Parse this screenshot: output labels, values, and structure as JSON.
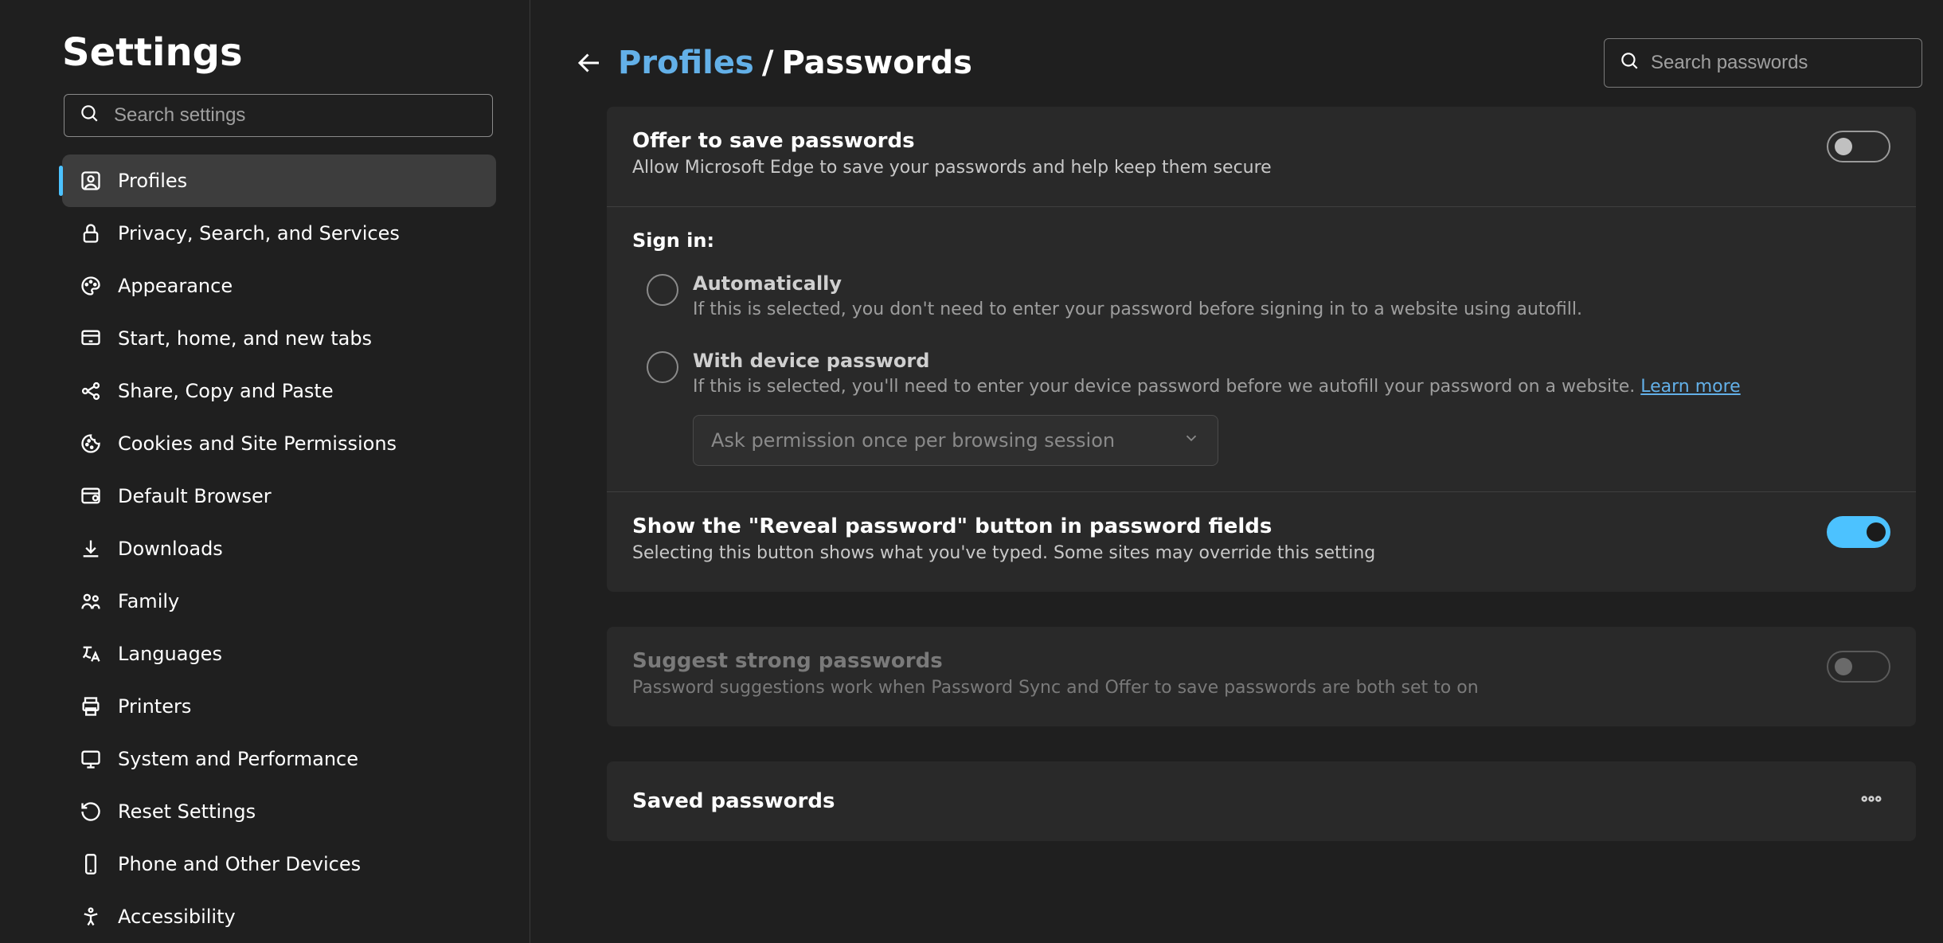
{
  "app_title": "Settings",
  "search_settings_placeholder": "Search settings",
  "nav": [
    {
      "id": "profiles",
      "label": "Profiles",
      "icon": "profile",
      "active": true
    },
    {
      "id": "privacy",
      "label": "Privacy, Search, and Services",
      "icon": "lock",
      "active": false
    },
    {
      "id": "appearance",
      "label": "Appearance",
      "icon": "palette",
      "active": false
    },
    {
      "id": "start",
      "label": "Start, home, and new tabs",
      "icon": "power",
      "active": false
    },
    {
      "id": "share",
      "label": "Share, Copy and Paste",
      "icon": "share",
      "active": false
    },
    {
      "id": "cookies",
      "label": "Cookies and Site Permissions",
      "icon": "cookie",
      "active": false
    },
    {
      "id": "browser",
      "label": "Default Browser",
      "icon": "browser",
      "active": false
    },
    {
      "id": "downloads",
      "label": "Downloads",
      "icon": "download",
      "active": false
    },
    {
      "id": "family",
      "label": "Family",
      "icon": "family",
      "active": false
    },
    {
      "id": "languages",
      "label": "Languages",
      "icon": "language",
      "active": false
    },
    {
      "id": "printers",
      "label": "Printers",
      "icon": "printer",
      "active": false
    },
    {
      "id": "system",
      "label": "System and Performance",
      "icon": "system",
      "active": false
    },
    {
      "id": "reset",
      "label": "Reset Settings",
      "icon": "reset",
      "active": false
    },
    {
      "id": "phone",
      "label": "Phone and Other Devices",
      "icon": "phone",
      "active": false
    },
    {
      "id": "accessibility",
      "label": "Accessibility",
      "icon": "accessibility",
      "active": false
    }
  ],
  "breadcrumb": {
    "parent": "Profiles",
    "separator": "/",
    "current": "Passwords"
  },
  "search_passwords_placeholder": "Search passwords",
  "offer_save": {
    "title": "Offer to save passwords",
    "desc": "Allow Microsoft Edge to save your passwords and help keep them secure",
    "on": false
  },
  "sign_in": {
    "label": "Sign in:",
    "auto": {
      "title": "Automatically",
      "desc": "If this is selected, you don't need to enter your password before signing in to a website using autofill."
    },
    "device": {
      "title": "With device password",
      "desc": "If this is selected, you'll need to enter your device password before we autofill your password on a website. ",
      "learn_more": "Learn more"
    },
    "select_value": "Ask permission once per browsing session"
  },
  "reveal": {
    "title": "Show the \"Reveal password\" button in password fields",
    "desc": "Selecting this button shows what you've typed. Some sites may override this setting",
    "on": true
  },
  "suggest": {
    "title": "Suggest strong passwords",
    "desc": "Password suggestions work when Password Sync and Offer to save passwords are both set to on",
    "on": false,
    "disabled": true
  },
  "saved": {
    "title": "Saved passwords"
  }
}
